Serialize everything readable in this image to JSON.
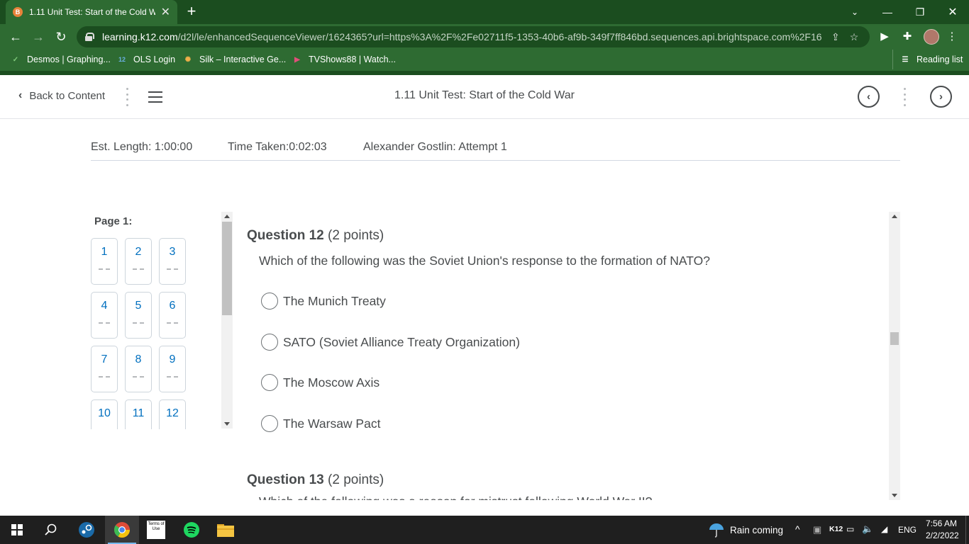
{
  "browser": {
    "tab_title": "1.11 Unit Test: Start of the Cold W",
    "tab_favicon": "B",
    "url_host": "learning.k12.com",
    "url_rest": "/d2l/le/enhancedSequenceViewer/1624365?url=https%3A%2F%2Fe02711f5-1353-40b6-af9b-349f7ff846bd.sequences.api.brightspace.com%2F16...",
    "bookmarks": [
      {
        "label": "Desmos | Graphing...",
        "icon": "desmos-icon"
      },
      {
        "label": "OLS Login",
        "icon": "k12-icon",
        "badge": "12"
      },
      {
        "label": "Silk – Interactive Ge...",
        "icon": "silk-icon"
      },
      {
        "label": "TVShows88 | Watch...",
        "icon": "play-icon"
      }
    ],
    "reading_list": "Reading list"
  },
  "header": {
    "back_label": "Back to Content",
    "title": "1.11 Unit Test: Start of the Cold War"
  },
  "quiz_info": {
    "est_length": "Est. Length: 1:00:00",
    "time_taken": "Time Taken:0:02:03",
    "attempt": "Alexander Gostlin: Attempt 1"
  },
  "page_nav": {
    "label": "Page 1:",
    "questions": [
      "1",
      "2",
      "3",
      "4",
      "5",
      "6",
      "7",
      "8",
      "9",
      "10",
      "11",
      "12"
    ]
  },
  "questions": [
    {
      "title": "Question 12",
      "points": "(2 points)",
      "text": "Which of the following was the Soviet Union's response to the formation of NATO?",
      "choices": [
        "The Munich Treaty",
        "SATO (Soviet Alliance Treaty Organization)",
        "The Moscow Axis",
        "The Warsaw Pact"
      ]
    },
    {
      "title": "Question 13",
      "points": "(2 points)",
      "text": "Which of the following was a reason for mistrust following World War II?"
    }
  ],
  "taskbar": {
    "weather": "Rain coming",
    "lang": "ENG",
    "tray_k12": "K12",
    "time": "7:56 AM",
    "date": "2/2/2022",
    "terms_label": "Terms of Use"
  },
  "colors": {
    "chrome_dark": "#1b4d1f",
    "chrome_light": "#2e6b32",
    "link_blue": "#006fbf",
    "text": "#494c4e"
  }
}
